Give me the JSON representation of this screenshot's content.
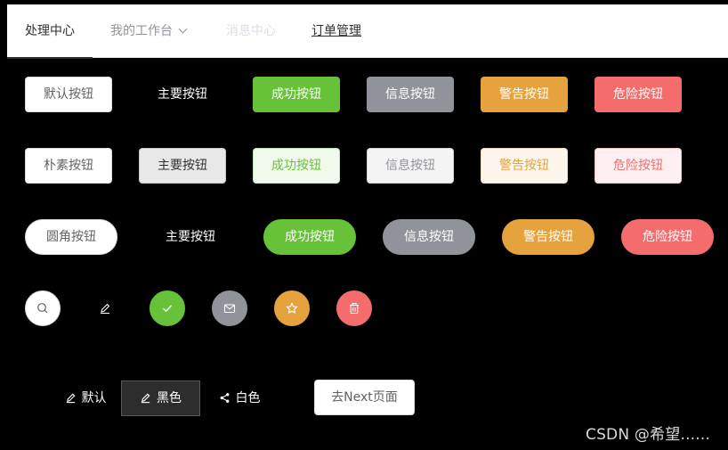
{
  "menu": {
    "items": [
      {
        "label": "处理中心"
      },
      {
        "label": "我的工作台"
      },
      {
        "label": "消息中心"
      },
      {
        "label": "订单管理"
      }
    ]
  },
  "row1": [
    "默认按钮",
    "主要按钮",
    "成功按钮",
    "信息按钮",
    "警告按钮",
    "危险按钮"
  ],
  "row2": [
    "朴素按钮",
    "主要按钮",
    "成功按钮",
    "信息按钮",
    "警告按钮",
    "危险按钮"
  ],
  "row3": [
    "圆角按钮",
    "主要按钮",
    "成功按钮",
    "信息按钮",
    "警告按钮",
    "危险按钮"
  ],
  "icons": [
    "search-icon",
    "edit-icon",
    "check-icon",
    "message-icon",
    "star-icon",
    "delete-icon"
  ],
  "group": {
    "default_label": "默认",
    "black_label": "黑色",
    "white_label": "白色"
  },
  "next_button": "去Next页面",
  "watermark": "CSDN @希望......",
  "colors": {
    "success": "#67c23a",
    "info": "#909399",
    "warning": "#e6a23c",
    "danger": "#f56c6c",
    "text_primary": "#303133",
    "text_regular": "#606266"
  }
}
